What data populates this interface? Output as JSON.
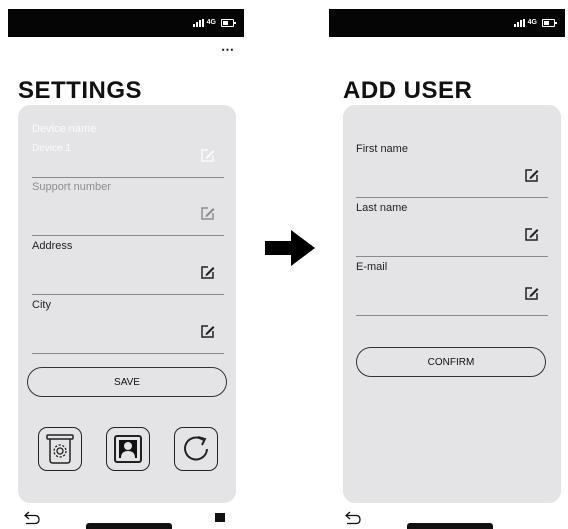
{
  "status_bar": {
    "network": "4G"
  },
  "settings_screen": {
    "menu_glyph": "⋯",
    "title": "SETTINGS",
    "fields": [
      {
        "label": "Device name",
        "value": "Device 1"
      },
      {
        "label": "Support number",
        "value": ""
      },
      {
        "label": "Address",
        "value": ""
      },
      {
        "label": "City",
        "value": ""
      }
    ],
    "save_label": "SAVE",
    "action_icons": [
      "camera-icon",
      "user-profile-icon",
      "refresh-icon"
    ]
  },
  "add_user_screen": {
    "title": "ADD USER",
    "fields": [
      {
        "label": "First name",
        "value": ""
      },
      {
        "label": "Last name",
        "value": ""
      },
      {
        "label": "E-mail",
        "value": ""
      }
    ],
    "confirm_label": "CONFIRM"
  },
  "transition_icon": "arrow-right-icon",
  "nav_icons": [
    "back-icon",
    "home-indicator",
    "recents-icon"
  ],
  "colors": {
    "status_bar": "#050505",
    "card_background": "#e4e4e6",
    "text": "#111111",
    "muted_text": "#8d8d8d"
  }
}
